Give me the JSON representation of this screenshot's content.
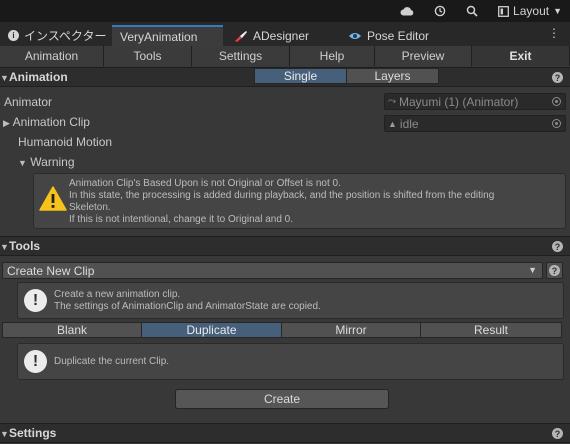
{
  "topbar": {
    "layout_label": "Layout",
    "icons": [
      "cloud-icon",
      "history-icon",
      "search-icon",
      "layout-icon"
    ]
  },
  "tabs": [
    {
      "label": "インスペクター",
      "icon": "info-icon"
    },
    {
      "label": "VeryAnimation",
      "active": true
    },
    {
      "label": "ADesigner",
      "icon": "brush-icon"
    },
    {
      "label": "Pose Editor",
      "icon": "eye-icon"
    }
  ],
  "menu": [
    "Animation",
    "Tools",
    "Settings",
    "Help",
    "Preview",
    "Exit"
  ],
  "animation_section": {
    "title": "Animation",
    "segments": {
      "single": "Single",
      "layers": "Layers"
    },
    "animator_label": "Animator",
    "animator_value": "Mayumi (1) (Animator)",
    "clip_label": "Animation Clip",
    "clip_value": "idle",
    "humanoid_label": "Humanoid Motion",
    "warning_label": "Warning",
    "warning_lines": [
      "Animation Clip's Based Upon is not Original or Offset is not 0.",
      "In this state, the processing is added during playback, and the position is shifted from the editing",
      "Skeleton.",
      "If this is not intentional, change it to Original and 0."
    ]
  },
  "tools_section": {
    "title": "Tools",
    "dropdown_value": "Create New Clip",
    "info_lines": [
      "Create a new animation clip.",
      "The settings of AnimationClip and AnimatorState are copied."
    ],
    "modes": [
      "Blank",
      "Duplicate",
      "Mirror",
      "Result"
    ],
    "selected_mode": "Duplicate",
    "mode_info": "Duplicate the current Clip.",
    "create_label": "Create"
  },
  "settings_section": {
    "title": "Settings"
  },
  "colors": {
    "accent": "#46607c",
    "highlight": "#ff1515",
    "background": "#383838"
  }
}
